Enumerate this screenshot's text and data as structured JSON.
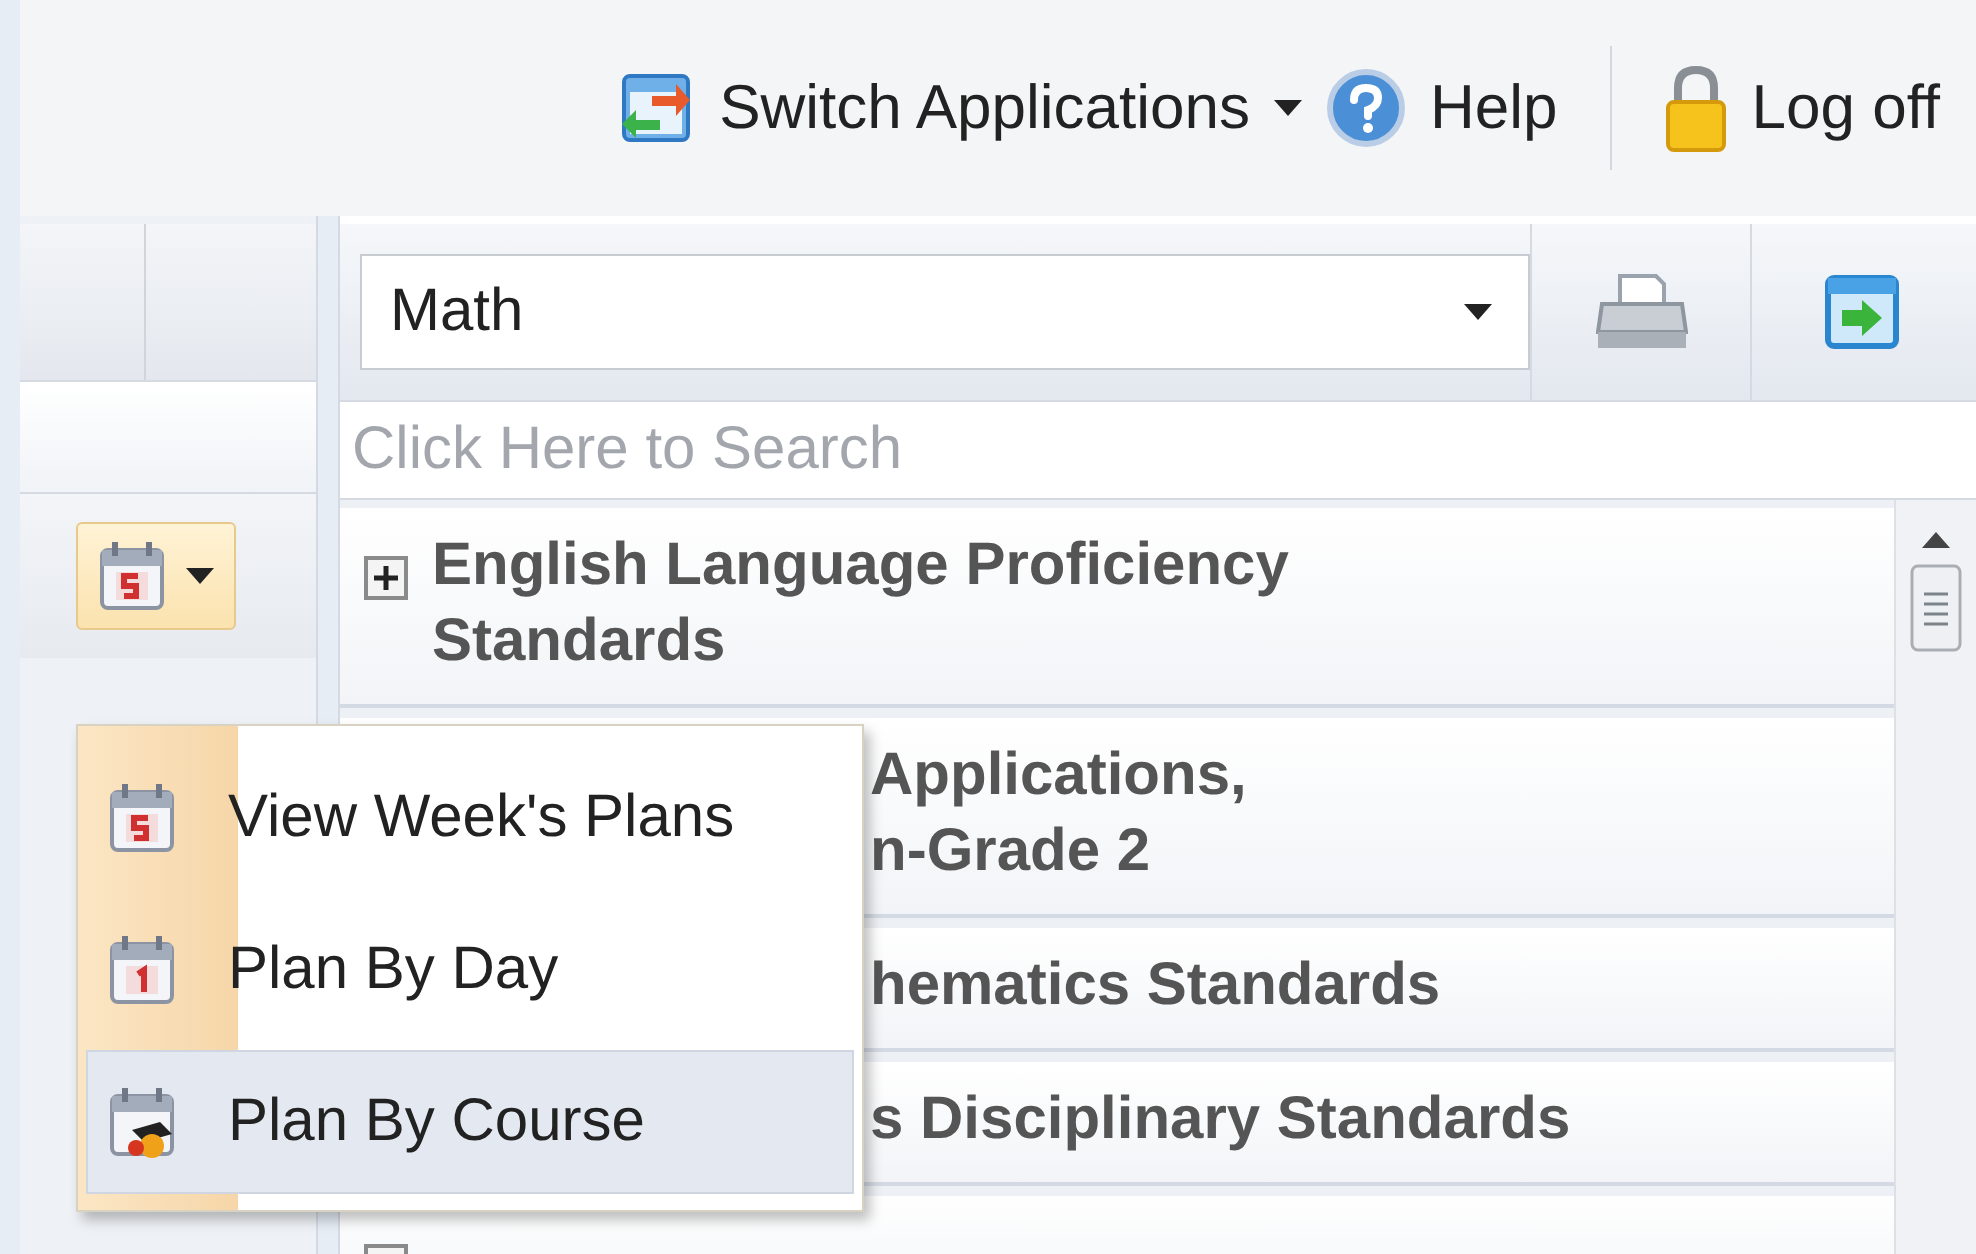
{
  "header": {
    "links": [
      {
        "kind": "switch",
        "label": "Switch Applications"
      },
      {
        "kind": "help",
        "label": "Help"
      },
      {
        "kind": "logoff",
        "label": "Log off"
      }
    ]
  },
  "subject_select": {
    "value": "Math"
  },
  "search": {
    "placeholder": "Click Here to Search"
  },
  "standards": [
    {
      "kind": "expandable",
      "lines": [
        "English Language Proficiency",
        "Standards"
      ]
    },
    {
      "kind": "partial",
      "lines": [
        "Applications,",
        "n-Grade 2"
      ]
    },
    {
      "kind": "partial",
      "lines": [
        "hematics Standards"
      ]
    },
    {
      "kind": "partial",
      "lines": [
        "s Disciplinary Standards"
      ]
    },
    {
      "kind": "stub"
    }
  ],
  "plan_menu": {
    "items": [
      {
        "kind": "week",
        "label": "View Week's Plans",
        "selected": false
      },
      {
        "kind": "day",
        "label": "Plan By Day",
        "selected": false
      },
      {
        "kind": "course",
        "label": "Plan By Course",
        "selected": true
      }
    ]
  }
}
